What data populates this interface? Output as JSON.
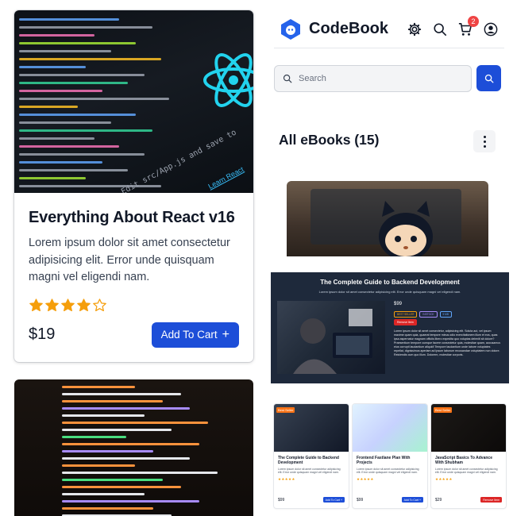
{
  "product_card": {
    "title": "Everything About React v16",
    "description": "Lorem ipsum dolor sit amet consectetur adipisicing elit. Error unde quisquam magni vel eligendi nam.",
    "rating": 4,
    "rating_max": 5,
    "price": "$19",
    "add_to_cart_label": "Add To Cart",
    "image_caption": "Edit src/App.js and save to",
    "image_link": "Learn React"
  },
  "header": {
    "brand": "CodeBook",
    "cart_count": "2",
    "icons": [
      "settings-gear-icon",
      "search-icon",
      "cart-icon",
      "user-account-icon"
    ]
  },
  "search": {
    "placeholder": "Search"
  },
  "listing": {
    "title": "All eBooks (15)"
  },
  "detail_preview": {
    "title": "The Complete Guide to Backend Development",
    "subtitle": "Lorem ipsum dolor sit amet consectetur adipisicing elit. Error unde quisquam magni vel eligendi nam.",
    "price": "$99",
    "tags": [
      "BEST SELLER",
      "INSTOCK",
      "5 MB"
    ],
    "remove_label": "Remove Item",
    "body": "Lorem ipsum dolor sit amet consectetur, adipisicing elit. Soluta aut, vel ipsum maxime quam quia, quaerat tempore minus odio exercitationem illum et eos, quas ipsa aspernatur magnam officiis libero expedita quo voluptas deleniti sit dolore? Praesentium tempore cumque facere consectetur quia, molestiae quam, accusamus eius corrupti laudantium aliquid! Tempore laudantium unde labore voluptates repellat, dignissimos aperiam ad ipsum laborum recusandae voluptatem non dolore. Reiciendis cum quo illum. Dolorem, molestiae corporis."
  },
  "mini_products": [
    {
      "badge": "Best Seller",
      "title": "The Complete Guide to Backend Development",
      "description": "Lorem ipsum dolor sit amet consectetur adipisicing elit. Error unde quisquam magni vel eligendi nam.",
      "stars": "★★★★★",
      "price": "$99",
      "button": "Add To Cart +",
      "button_color": "#1d4ed8"
    },
    {
      "badge": "",
      "title": "Frontend Fastlane Plan With Projects",
      "description": "Lorem ipsum dolor sit amet consectetur adipisicing elit. Error unde quisquam magni vel eligendi nam.",
      "stars": "★★★★★",
      "price": "$99",
      "button": "Add To Cart +",
      "button_color": "#1d4ed8"
    },
    {
      "badge": "Best Seller",
      "title": "JavaScript Basics To Advance With Shubham",
      "description": "Lorem ipsum dolor sit amet consectetur adipisicing elit. Error unde quisquam magni vel eligendi nam.",
      "stars": "★★★★★",
      "price": "$29",
      "button": "Remove Item",
      "button_color": "#dc2626"
    }
  ],
  "colors": {
    "primary": "#1d4ed8",
    "star": "#f59e0b",
    "danger": "#dc2626",
    "badge": "#ef4444",
    "dark_panel": "#1e293b"
  }
}
